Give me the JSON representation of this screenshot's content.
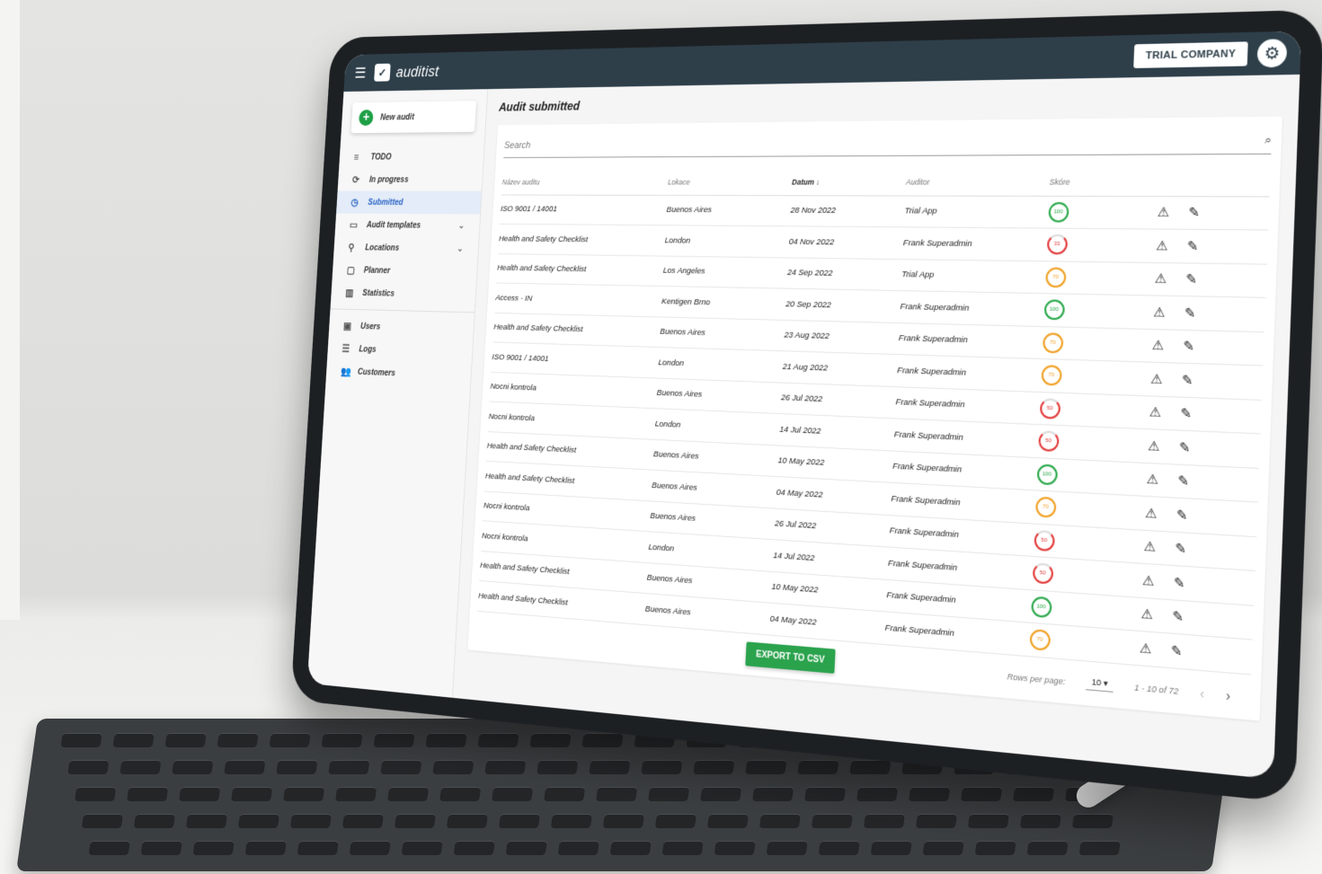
{
  "header": {
    "app_name": "auditist",
    "company_button": "TRIAL COMPANY",
    "menu_icon": "menu-icon",
    "settings_icon": "gear-icon"
  },
  "sidebar": {
    "new_audit": "New audit",
    "items": [
      {
        "label": "TODO",
        "icon": "todo-list-icon"
      },
      {
        "label": "In progress",
        "icon": "sync-icon"
      },
      {
        "label": "Submitted",
        "icon": "history-icon",
        "active": true
      },
      {
        "label": "Audit templates",
        "icon": "template-icon",
        "expandable": true
      },
      {
        "label": "Locations",
        "icon": "location-pin-icon",
        "expandable": true
      },
      {
        "label": "Planner",
        "icon": "calendar-icon"
      },
      {
        "label": "Statistics",
        "icon": "chart-icon"
      },
      {
        "label": "Users",
        "icon": "user-icon"
      },
      {
        "label": "Logs",
        "icon": "log-icon"
      },
      {
        "label": "Customers",
        "icon": "people-icon"
      }
    ]
  },
  "main": {
    "title": "Audit submitted",
    "search_placeholder": "Search",
    "columns": [
      "Název auditu",
      "Lokace",
      "Datum",
      "Auditor",
      "Skóre"
    ],
    "sort_indicator": "↓",
    "rows": [
      {
        "name": "ISO 9001 / 14001",
        "location": "Buenos Aires",
        "date": "28 Nov 2022",
        "auditor": "Trial App",
        "score": "100",
        "score_color": "green"
      },
      {
        "name": "Health and Safety Checklist",
        "location": "London",
        "date": "04 Nov 2022",
        "auditor": "Frank Superadmin",
        "score": "33",
        "score_color": "red"
      },
      {
        "name": "Health and Safety Checklist",
        "location": "Los Angeles",
        "date": "24 Sep 2022",
        "auditor": "Trial App",
        "score": "70",
        "score_color": "orange"
      },
      {
        "name": "Access - IN",
        "location": "Kentigen Brno",
        "date": "20 Sep 2022",
        "auditor": "Frank Superadmin",
        "score": "100",
        "score_color": "green"
      },
      {
        "name": "Health and Safety Checklist",
        "location": "Buenos Aires",
        "date": "23 Aug 2022",
        "auditor": "Frank Superadmin",
        "score": "70",
        "score_color": "orange"
      },
      {
        "name": "ISO 9001 / 14001",
        "location": "London",
        "date": "21 Aug 2022",
        "auditor": "Frank Superadmin",
        "score": "70",
        "score_color": "orange"
      },
      {
        "name": "Nocni kontrola",
        "location": "Buenos Aires",
        "date": "26 Jul 2022",
        "auditor": "Frank Superadmin",
        "score": "50",
        "score_color": "red"
      },
      {
        "name": "Nocni kontrola",
        "location": "London",
        "date": "14 Jul 2022",
        "auditor": "Frank Superadmin",
        "score": "50",
        "score_color": "red"
      },
      {
        "name": "Health and Safety Checklist",
        "location": "Buenos Aires",
        "date": "10 May 2022",
        "auditor": "Frank Superadmin",
        "score": "100",
        "score_color": "green"
      },
      {
        "name": "Health and Safety Checklist",
        "location": "Buenos Aires",
        "date": "04 May 2022",
        "auditor": "Frank Superadmin",
        "score": "70",
        "score_color": "orange"
      },
      {
        "name": "Nocni kontrola",
        "location": "Buenos Aires",
        "date": "26 Jul 2022",
        "auditor": "Frank Superadmin",
        "score": "50",
        "score_color": "red"
      },
      {
        "name": "Nocni kontrola",
        "location": "London",
        "date": "14 Jul 2022",
        "auditor": "Frank Superadmin",
        "score": "50",
        "score_color": "red"
      },
      {
        "name": "Health and Safety Checklist",
        "location": "Buenos Aires",
        "date": "10 May 2022",
        "auditor": "Frank Superadmin",
        "score": "100",
        "score_color": "green"
      },
      {
        "name": "Health and Safety Checklist",
        "location": "Buenos Aires",
        "date": "04 May 2022",
        "auditor": "Frank Superadmin",
        "score": "70",
        "score_color": "orange"
      }
    ],
    "row_actions": {
      "warning_icon": "warning-triangle-icon",
      "edit_icon": "pencil-edit-icon"
    },
    "footer": {
      "export_button": "EXPORT TO CSV",
      "rows_per_page_label": "Rows per page:",
      "rows_per_page_value": "10",
      "range": "1 - 10 of 72"
    }
  },
  "colors": {
    "header": "#2e3f4a",
    "accent_green": "#2ba34d",
    "active_blue": "#2a64c4",
    "score_green": "#2aa84a",
    "score_orange": "#f0a024",
    "score_red": "#e33a3a"
  }
}
